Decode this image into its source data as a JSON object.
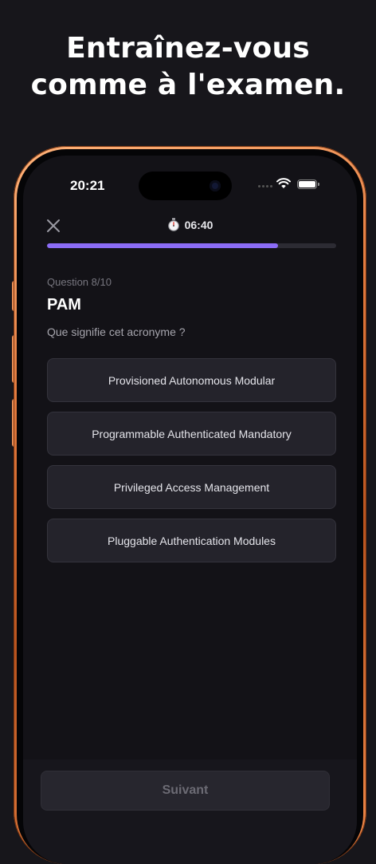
{
  "headline": {
    "line1": "Entraînez-vous",
    "line2": "comme à l'examen."
  },
  "status_bar": {
    "time": "20:21"
  },
  "quiz": {
    "timer": "06:40",
    "progress": 0.8,
    "counter": "Question 8/10",
    "title": "PAM",
    "subtitle": "Que signifie cet acronyme ?",
    "answers": [
      "Provisioned Autonomous Modular",
      "Programmable Authenticated Mandatory",
      "Privileged Access Management",
      "Pluggable Authentication Modules"
    ],
    "next_label": "Suivant"
  },
  "colors": {
    "accent": "#8b6cf6",
    "frame": "#e27a3e",
    "background": "#131217"
  }
}
